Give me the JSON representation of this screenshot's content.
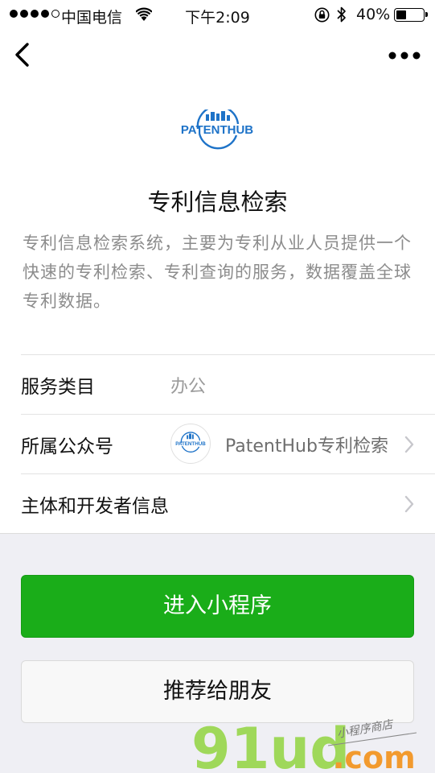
{
  "status_bar": {
    "carrier": "中国电信",
    "time": "下午2:09",
    "battery_percent": "40%",
    "battery_level": 0.4,
    "signal_bars_filled": 4,
    "signal_bars_total": 5
  },
  "nav": {
    "back_icon": "chevron-left-icon",
    "more_icon": "more-dots-icon"
  },
  "app": {
    "logo_text": "PATENTHUB",
    "title": "专利信息检索",
    "description": "专利信息检索系统，主要为专利从业人员提供一个快速的专利检索、专利查询的服务，数据覆盖全球专利数据。"
  },
  "info_rows": [
    {
      "label": "服务类目",
      "value": "办公"
    },
    {
      "label": "所属公众号",
      "value": "PatentHub专利检索",
      "avatar_text": "PATENTHUB"
    },
    {
      "label": "主体和开发者信息",
      "value": ""
    }
  ],
  "buttons": {
    "enter": "进入小程序",
    "share": "推荐给朋友"
  },
  "watermark": {
    "brand": "91ud",
    "suffix": ".com",
    "tagline": "小程序商店"
  },
  "colors": {
    "primary_green": "#1aad19",
    "logo_blue": "#1e73c8",
    "watermark_green": "#9fd85a",
    "watermark_orange": "#f29a2e"
  }
}
